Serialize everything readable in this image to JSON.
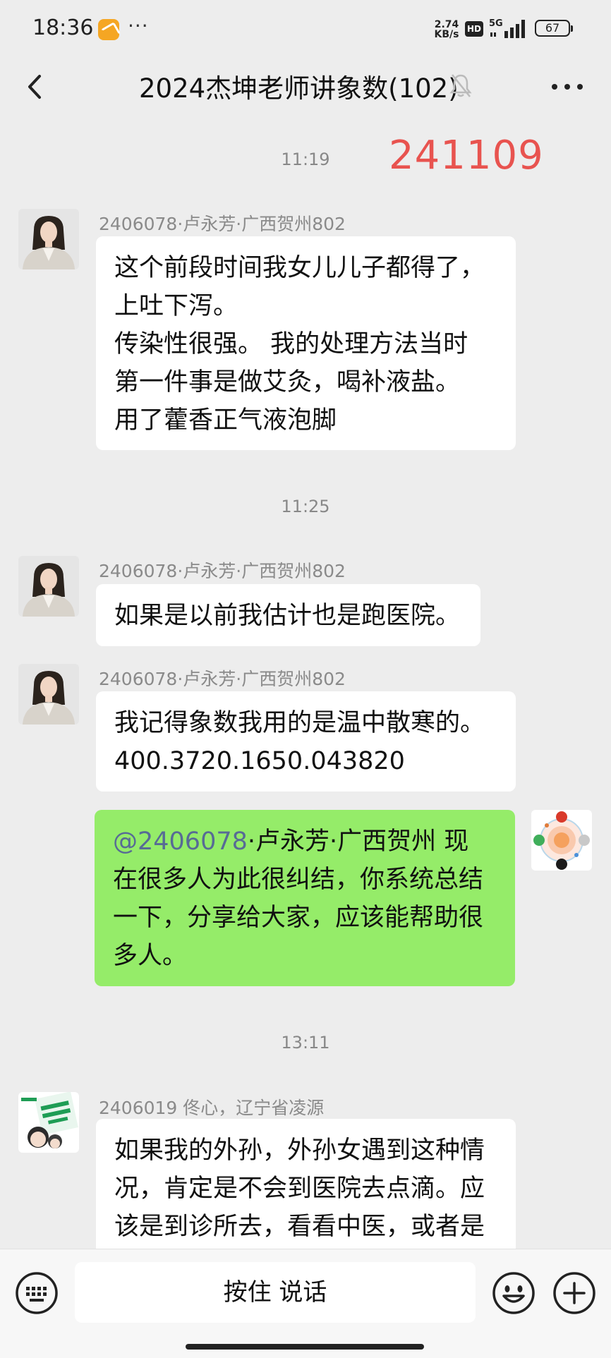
{
  "status_bar": {
    "time": "18:36",
    "more": "···",
    "speed_value": "2.74",
    "speed_unit": "KB/s",
    "hd": "HD",
    "network": "5G",
    "battery": "67"
  },
  "header": {
    "title": "2024杰坤老师讲象数(102)",
    "back_icon": "chevron-left-icon",
    "mute_icon": "bell-off-icon",
    "more_icon": "more-horizontal-icon"
  },
  "overlay_number": "241109",
  "messages": {
    "t1": "11:19",
    "m1": {
      "sender": "2406078·卢永芳·广西贺州802",
      "lines": [
        "这个前段时间我女儿儿子都得了，",
        "上吐下泻。",
        "传染性很强。 我的处理方法当时",
        "第一件事是做艾灸，喝补液盐。",
        "用了藿香正气液泡脚"
      ]
    },
    "t2": "11:25",
    "m2": {
      "sender": "2406078·卢永芳·广西贺州802",
      "lines": [
        "如果是以前我估计也是跑医院。"
      ]
    },
    "m3": {
      "sender": "2406078·卢永芳·广西贺州802",
      "lines": [
        "我记得象数我用的是温中散寒的。",
        "400.3720.1650.043820"
      ]
    },
    "m4": {
      "mention": "@2406078",
      "lines": [
        "·卢永芳·广西贺州  现",
        "在很多人为此很纠结，你系统总结",
        "一下，分享给大家，应该能帮助很",
        "多人。"
      ]
    },
    "t3": "13:11",
    "m5": {
      "sender": "2406019  佟心，辽宁省凌源",
      "lines": [
        "如果我的外孙，外孙女遇到这种情",
        "况，肯定是不会到医院去点滴。应",
        "该是到诊所去，看看中医，或者是"
      ]
    }
  },
  "input_bar": {
    "voice_label": "按住 说话",
    "keyboard_icon": "keyboard-icon",
    "emoji_icon": "smile-icon",
    "plus_icon": "plus-circle-icon"
  }
}
